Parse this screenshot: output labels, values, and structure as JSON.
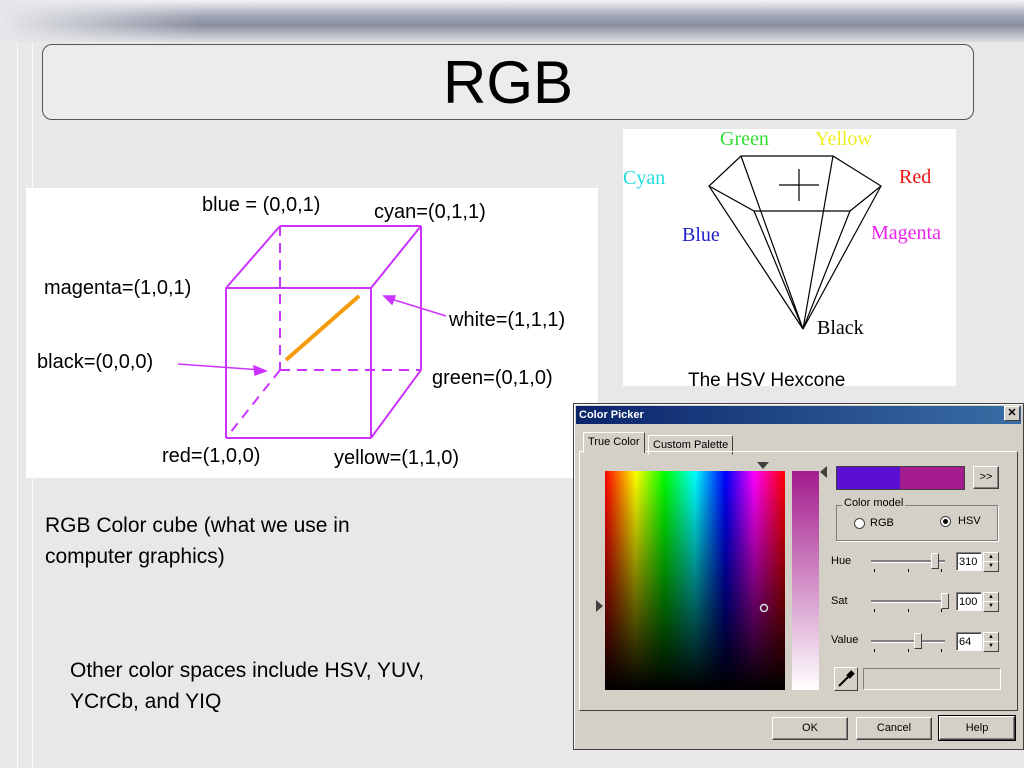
{
  "slide": {
    "title": "RGB",
    "text_cube_caption": "RGB Color cube (what we use in computer graphics)",
    "text_cube_caption_line1": "RGB Color cube (what we use in",
    "text_cube_caption_line2": "computer graphics)",
    "text_other_line1": "Other color spaces include HSV, YUV,",
    "text_other_line2": "YCrCb, and YIQ"
  },
  "cube_diagram": {
    "blue": "blue = (0,0,1)",
    "cyan": "cyan=(0,1,1)",
    "magenta": "magenta=(1,0,1)",
    "white": "white=(1,1,1)",
    "black": "black=(0,0,0)",
    "green": "green=(0,1,0)",
    "red": "red=(1,0,0)",
    "yellow": "yellow=(1,1,0)",
    "cube_color": "#cc33ff",
    "diagonal_color": "#f59a0a"
  },
  "hexcone_diagram": {
    "green": "Green",
    "yellow": "Yellow",
    "cyan": "Cyan",
    "red": "Red",
    "blue": "Blue",
    "magenta": "Magenta",
    "black": "Black",
    "caption": "The HSV Hexcone",
    "colors": {
      "green": "#33dd33",
      "yellow": "#eeee22",
      "cyan": "#22dddd",
      "red": "#ee1111",
      "blue": "#2222cc",
      "magenta": "#ee22ee"
    }
  },
  "color_picker": {
    "window_title": "Color Picker",
    "close_icon": "close-icon",
    "tabs": [
      "True Color",
      "Custom Palette"
    ],
    "more_button": ">>",
    "color_model_label": "Color model",
    "radio_rgb": "RGB",
    "radio_hsv": "HSV",
    "selected_model": "HSV",
    "hue_label": "Hue",
    "hue_value": "310",
    "sat_label": "Sat",
    "sat_value": "100",
    "value_label": "Value",
    "value_value": "64",
    "hue_level": 310,
    "sat_level": 100,
    "value_level": 64,
    "new_color": "#5b10d1",
    "old_color": "#a31b8c",
    "ok_button": "OK",
    "cancel_button": "Cancel",
    "help_button": "Help",
    "eyedropper_icon": "eyedropper-icon"
  }
}
